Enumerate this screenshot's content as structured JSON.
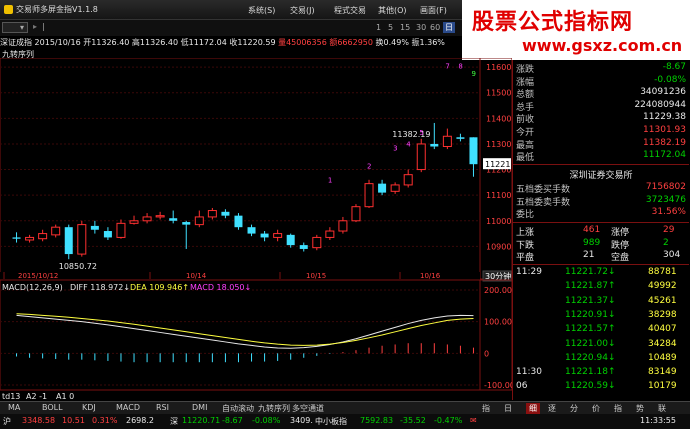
{
  "window": {
    "title": "交易师多屏金指V1.1.8",
    "menu": [
      "系统(S)",
      "交易(J)",
      "程式交易",
      "其他(O)",
      "画面(F)"
    ]
  },
  "banner": {
    "line1": "股票公式指标网",
    "line2": "www.gsxz.com.cn"
  },
  "toolbar": {
    "items": [
      "",
      "1",
      "5",
      "15",
      "30",
      "60",
      "日",
      "周",
      "月"
    ],
    "active": "日"
  },
  "info": {
    "name": "深证成指",
    "date": "2015/10/16",
    "open": "开11326.40",
    "high": "高11326.40",
    "low": "低11172.04",
    "close": "收11220.59",
    "vol": "量45006356",
    "amount": "额6662950",
    "turnover": "换0.49%",
    "amp": "振1.36%"
  },
  "indicator_title": "九转序列",
  "chart_data": [
    {
      "type": "candlestick",
      "title": "深证成指",
      "x": [
        "2015/10/12",
        "",
        "",
        "10/14",
        "",
        "10/15",
        "",
        "10/16"
      ],
      "ylim": [
        10800,
        11620
      ],
      "y_ticks": [
        11600,
        11500,
        11400,
        11300,
        11200,
        11100,
        11000,
        10900
      ],
      "annotations": [
        {
          "label": "11382.19",
          "value": 11382.19
        },
        {
          "label": "10850.72",
          "value": 10850.72
        }
      ],
      "nine_turn_labels": [
        "1",
        "2",
        "3",
        "4",
        "5",
        "7",
        "8",
        "9"
      ],
      "x_labels": [
        "2015/10/12",
        "10/14",
        "10/15",
        "10/16"
      ],
      "period_label": "30分钟",
      "current_price": "11221",
      "candles": [
        {
          "o": 10935,
          "c": 10930,
          "h": 10955,
          "l": 10915
        },
        {
          "o": 10925,
          "c": 10935,
          "h": 10945,
          "l": 10915
        },
        {
          "o": 10930,
          "c": 10950,
          "h": 10965,
          "l": 10920
        },
        {
          "o": 10945,
          "c": 10975,
          "h": 10985,
          "l": 10935
        },
        {
          "o": 10975,
          "c": 10870,
          "h": 10985,
          "l": 10850
        },
        {
          "o": 10870,
          "c": 10985,
          "h": 11000,
          "l": 10860
        },
        {
          "o": 10980,
          "c": 10965,
          "h": 11000,
          "l": 10950
        },
        {
          "o": 10960,
          "c": 10935,
          "h": 10975,
          "l": 10925
        },
        {
          "o": 10935,
          "c": 10990,
          "h": 11005,
          "l": 10930
        },
        {
          "o": 10990,
          "c": 11000,
          "h": 11020,
          "l": 10985
        },
        {
          "o": 11000,
          "c": 11015,
          "h": 11030,
          "l": 10990
        },
        {
          "o": 11015,
          "c": 11020,
          "h": 11035,
          "l": 11005
        },
        {
          "o": 11010,
          "c": 11000,
          "h": 11040,
          "l": 10990
        },
        {
          "o": 10995,
          "c": 10985,
          "h": 11000,
          "l": 10890
        },
        {
          "o": 10985,
          "c": 11015,
          "h": 11040,
          "l": 10975
        },
        {
          "o": 11015,
          "c": 11040,
          "h": 11050,
          "l": 11005
        },
        {
          "o": 11035,
          "c": 11020,
          "h": 11045,
          "l": 11010
        },
        {
          "o": 11020,
          "c": 10975,
          "h": 11030,
          "l": 10965
        },
        {
          "o": 10975,
          "c": 10950,
          "h": 10985,
          "l": 10940
        },
        {
          "o": 10950,
          "c": 10935,
          "h": 10960,
          "l": 10920
        },
        {
          "o": 10935,
          "c": 10950,
          "h": 10965,
          "l": 10920
        },
        {
          "o": 10945,
          "c": 10905,
          "h": 10950,
          "l": 10895
        },
        {
          "o": 10905,
          "c": 10890,
          "h": 10915,
          "l": 10880
        },
        {
          "o": 10895,
          "c": 10935,
          "h": 10945,
          "l": 10885
        },
        {
          "o": 10935,
          "c": 10960,
          "h": 10975,
          "l": 10925
        },
        {
          "o": 10960,
          "c": 11000,
          "h": 11015,
          "l": 10950
        },
        {
          "o": 11000,
          "c": 11055,
          "h": 11065,
          "l": 10995
        },
        {
          "o": 11055,
          "c": 11145,
          "h": 11160,
          "l": 11050
        },
        {
          "o": 11145,
          "c": 11110,
          "h": 11160,
          "l": 11100
        },
        {
          "o": 11115,
          "c": 11140,
          "h": 11150,
          "l": 11105
        },
        {
          "o": 11140,
          "c": 11180,
          "h": 11200,
          "l": 11130
        },
        {
          "o": 11200,
          "c": 11300,
          "h": 11320,
          "l": 11190
        },
        {
          "o": 11300,
          "c": 11290,
          "h": 11382,
          "l": 11280
        },
        {
          "o": 11290,
          "c": 11330,
          "h": 11360,
          "l": 11280
        },
        {
          "o": 11326,
          "c": 11320,
          "h": 11340,
          "l": 11310
        },
        {
          "o": 11326,
          "c": 11221,
          "h": 11326,
          "l": 11172
        }
      ]
    },
    {
      "type": "line",
      "title": "MACD(12,26,9)",
      "legend": [
        {
          "name": "DIFF",
          "value": "118.972↓",
          "color": "#e8e8e8"
        },
        {
          "name": "DEA",
          "value": "109.946↑",
          "color": "#ffff40"
        },
        {
          "name": "MACD",
          "value": "18.050↓",
          "color": "#ff40ff"
        }
      ],
      "ylim": [
        -100,
        200
      ],
      "y_ticks": [
        "200.00",
        "100.00",
        "0",
        "-100.00"
      ],
      "diff": [
        120,
        116,
        112,
        108,
        104,
        100,
        95,
        90,
        84,
        78,
        72,
        66,
        60,
        54,
        48,
        42,
        36,
        30,
        25,
        20,
        17,
        16,
        18,
        22,
        28,
        36,
        46,
        58,
        70,
        82,
        94,
        104,
        112,
        118,
        120,
        119
      ],
      "dea": [
        125,
        123,
        120,
        117,
        114,
        110,
        106,
        102,
        97,
        92,
        86,
        80,
        74,
        68,
        62,
        56,
        50,
        44,
        38,
        33,
        29,
        26,
        25,
        26,
        29,
        34,
        41,
        49,
        58,
        68,
        78,
        88,
        96,
        104,
        108,
        110
      ],
      "macd": [
        -10,
        -14,
        -16,
        -18,
        -20,
        -20,
        -22,
        -24,
        -26,
        -28,
        -28,
        -28,
        -28,
        -28,
        -28,
        -28,
        -28,
        -28,
        -26,
        -26,
        -24,
        -20,
        -14,
        -8,
        -2,
        4,
        10,
        18,
        24,
        28,
        32,
        32,
        32,
        28,
        24,
        18
      ]
    }
  ],
  "lower": {
    "td": "td13",
    "a2": "A2 -1",
    "a1": "A1 0"
  },
  "quote": {
    "rows": [
      {
        "l": "涨跌",
        "v": "-8.67",
        "c": "green"
      },
      {
        "l": "涨幅",
        "v": "-0.08%",
        "c": "green"
      },
      {
        "l": "总额",
        "v": "34091236",
        "c": "white"
      },
      {
        "l": "总手",
        "v": "224080944",
        "c": "white"
      },
      {
        "l": "前收",
        "v": "11229.38",
        "c": "white"
      },
      {
        "l": "今开",
        "v": "11301.93",
        "c": "red"
      },
      {
        "l": "最高",
        "v": "11382.19",
        "c": "red"
      },
      {
        "l": "最低",
        "v": "11172.04",
        "c": "green"
      }
    ],
    "exchange": "深圳证券交易所",
    "rows2": [
      {
        "l": "五档委买手数",
        "v": "7156802",
        "c": "red"
      },
      {
        "l": "五档委卖手数",
        "v": "3723476",
        "c": "green"
      },
      {
        "l": "委比",
        "v": "31.56%",
        "c": "red"
      }
    ],
    "breadth": [
      {
        "l": "上涨",
        "n": "461",
        "m": "涨停",
        "k": "29",
        "nc": "red"
      },
      {
        "l": "下跌",
        "n": "989",
        "m": "跌停",
        "k": "2",
        "nc": "green"
      },
      {
        "l": "平盘",
        "n": "21",
        "m": "空盘",
        "k": "304",
        "nc": "white"
      }
    ],
    "ticks": [
      {
        "t": "11:29",
        "p": "11221.72",
        "d": "↓",
        "v": "88781"
      },
      {
        "t": "",
        "p": "11221.87",
        "d": "↑",
        "v": "49992"
      },
      {
        "t": "",
        "p": "11221.37",
        "d": "↓",
        "v": "45261"
      },
      {
        "t": "",
        "p": "11220.91",
        "d": "↓",
        "v": "38298"
      },
      {
        "t": "",
        "p": "11221.57",
        "d": "↑",
        "v": "40407"
      },
      {
        "t": "",
        "p": "11221.00",
        "d": "↓",
        "v": "34284"
      },
      {
        "t": "",
        "p": "11220.94",
        "d": "↓",
        "v": "10489"
      },
      {
        "t": "11:30",
        "p": "11221.18",
        "d": "↑",
        "v": "83149"
      },
      {
        "t": "06",
        "p": "11220.59",
        "d": "↓",
        "v": "10179"
      }
    ]
  },
  "tabs": [
    "MA",
    "BOLL",
    "KDJ",
    "MACD",
    "RSI",
    "DMI",
    "自动滚动",
    "九转序列",
    "多空通道"
  ],
  "right_tabs": [
    "指",
    "日",
    "细",
    "逐",
    "分",
    "价",
    "指",
    "势",
    "联"
  ],
  "status": {
    "sh_label": "沪",
    "sh": "3348.58",
    "sh_chg": "10.51",
    "sh_pct": "0.31%",
    "sh_amt": "2698.2",
    "sz_label": "深",
    "sz": "11220.71",
    "sz_chg": "-8.67",
    "sz_pct": "-0.08%",
    "sz_amt": "3409.",
    "zx_label": "中小板指",
    "zx": "7592.83",
    "zx_chg": "-35.52",
    "zx_pct": "-0.47%",
    "clock": "11:33:55"
  }
}
